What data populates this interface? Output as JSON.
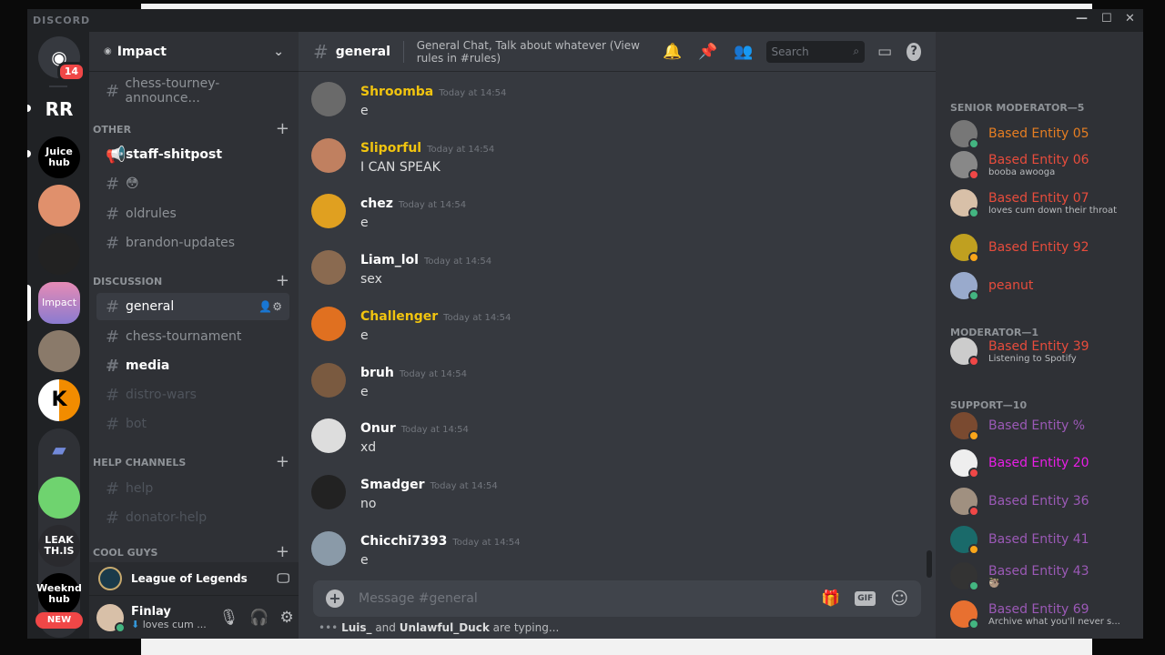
{
  "window": {
    "brand": "DISCORD",
    "minimize": "—",
    "maximize": "☐",
    "close": "✕"
  },
  "servers": {
    "home_badge": "14",
    "rr": "RR",
    "juice": "Juice hub",
    "impact": "Impact",
    "leak": "LEAK TH.IS",
    "weeknd": "Weeknd hub",
    "new_badge": "NEW"
  },
  "guild": {
    "name": "Impact"
  },
  "channels": {
    "top": "chess-tourney-announce...",
    "cat_other": "OTHER",
    "other": [
      "staff-shitpost",
      "😳",
      "oldrules",
      "brandon-updates"
    ],
    "cat_discussion": "DISCUSSION",
    "discussion": [
      "general",
      "chess-tournament",
      "media",
      "distro-wars",
      "bot"
    ],
    "cat_help": "HELP CHANNELS",
    "help": [
      "help",
      "donator-help"
    ],
    "cat_cool": "COOL GUYS"
  },
  "activity": {
    "game": "League of Legends"
  },
  "user": {
    "name": "Finlay",
    "status": "loves cum ..."
  },
  "header": {
    "channel": "general",
    "topic": "General Chat, Talk about whatever (View rules in #rules)",
    "search_placeholder": "Search"
  },
  "messages": [
    {
      "author": "Shroomba",
      "time": "Today at 14:54",
      "text": "e",
      "color": "#f1c40f"
    },
    {
      "author": "Sliporful",
      "time": "Today at 14:54",
      "text": "I CAN SPEAK",
      "color": "#f1c40f"
    },
    {
      "author": "chez",
      "time": "Today at 14:54",
      "text": "e",
      "color": "#ffffff"
    },
    {
      "author": "Liam_lol",
      "time": "Today at 14:54",
      "text": "sex",
      "color": "#ffffff"
    },
    {
      "author": "Challenger",
      "time": "Today at 14:54",
      "text": "e",
      "color": "#f1c40f"
    },
    {
      "author": "bruh",
      "time": "Today at 14:54",
      "text": "e",
      "color": "#ffffff"
    },
    {
      "author": "Onur",
      "time": "Today at 14:54",
      "text": "xd",
      "color": "#ffffff"
    },
    {
      "author": "Smadger",
      "time": "Today at 14:54",
      "text": "no",
      "color": "#ffffff"
    },
    {
      "author": "Chicchi7393",
      "time": "Today at 14:54",
      "text": "e",
      "color": "#ffffff"
    }
  ],
  "composer": {
    "placeholder": "Message #general",
    "gif": "GIF"
  },
  "typing": {
    "user1": "Luis_",
    "and": " and ",
    "user2": "Unlawful_Duck",
    "suffix": " are typing..."
  },
  "members": {
    "senior": "SENIOR MODERATOR—5",
    "moderator": "MODERATOR—1",
    "support": "SUPPORT—10",
    "list": [
      {
        "name": "Based Entity 05",
        "status": "",
        "color": "#e67e22",
        "presence": "online"
      },
      {
        "name": "Based Entity 06",
        "status": "booba awooga",
        "color": "#e74c3c",
        "presence": "dnd"
      },
      {
        "name": "Based Entity 07",
        "status": "loves cum down their throat",
        "color": "#e74c3c",
        "presence": "online"
      },
      {
        "name": "Based Entity 92",
        "status": "",
        "color": "#e74c3c",
        "presence": "idle"
      },
      {
        "name": "peanut",
        "status": "",
        "color": "#e74c3c",
        "presence": "mobile"
      },
      {
        "name": "Based Entity 39",
        "status": "Listening to Spotify",
        "color": "#e74c3c",
        "presence": "dnd"
      },
      {
        "name": "Based Entity %",
        "status": "",
        "color": "#9b59b6",
        "presence": "idle"
      },
      {
        "name": "Based Entity 20",
        "status": "",
        "color": "#e91ee6",
        "presence": "dnd"
      },
      {
        "name": "Based Entity 36",
        "status": "",
        "color": "#9b59b6",
        "presence": "dnd"
      },
      {
        "name": "Based Entity 41",
        "status": "",
        "color": "#9b59b6",
        "presence": "idle"
      },
      {
        "name": "Based Entity 43",
        "status": "🦥",
        "color": "#9b59b6",
        "presence": "online"
      },
      {
        "name": "Based Entity 69",
        "status": "Archive what you'll never s...",
        "color": "#9b59b6",
        "presence": "online"
      }
    ]
  },
  "colors": {
    "online": "#43b581",
    "dnd": "#f04747",
    "idle": "#faa61a",
    "mobile": "#43b581",
    "blurple": "#7289da"
  }
}
